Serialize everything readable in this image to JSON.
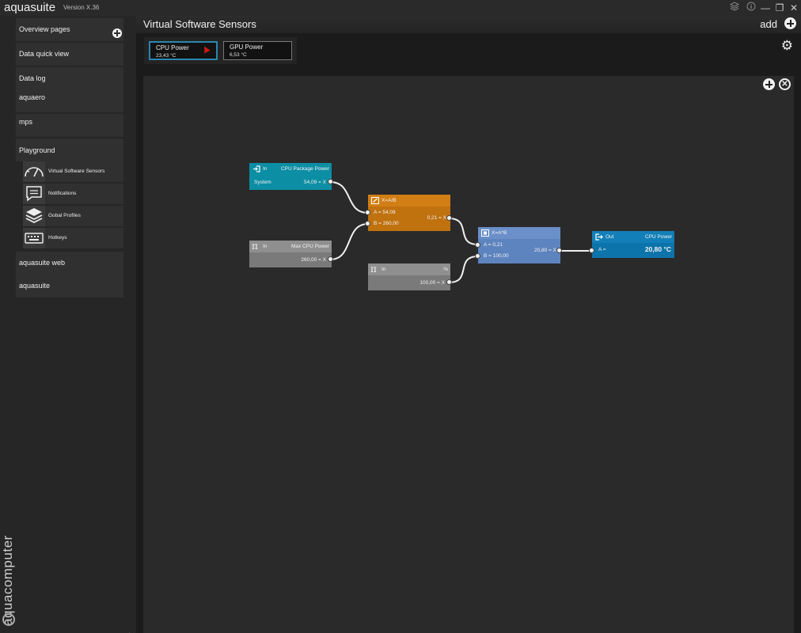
{
  "app": {
    "name": "aquasuite",
    "version": "Version X.36"
  },
  "window_controls": {
    "stack_icon": "stack-icon",
    "info_icon": "info-icon",
    "minimize": "—",
    "maximize": "❐",
    "close": "✕"
  },
  "sidebar": {
    "items": [
      {
        "label": "Overview pages"
      },
      {
        "label": "Data quick view"
      },
      {
        "label": "Data log"
      },
      {
        "label": "aquaero"
      },
      {
        "label": "mps"
      },
      {
        "label": "Playground"
      }
    ],
    "subitems": [
      {
        "label": "Virtual Software Sensors",
        "icon": "gauge-icon"
      },
      {
        "label": "Notifications",
        "icon": "chat-icon"
      },
      {
        "label": "Gobal Profiles",
        "icon": "layers-icon"
      },
      {
        "label": "Hotkeys",
        "icon": "keyboard-icon"
      }
    ],
    "bottom_items": [
      {
        "label": "aquasuite web"
      },
      {
        "label": "aquasuite"
      }
    ],
    "brand": "aquacomputer"
  },
  "header": {
    "title": "Virtual Software Sensors",
    "add_label": "add"
  },
  "sensor_tabs": [
    {
      "name": "CPU Power",
      "value": "23,43 °C",
      "active": true
    },
    {
      "name": "GPU Power",
      "value": "6,53 °C",
      "active": false
    }
  ],
  "nodes": {
    "in_cpu": {
      "type": "In",
      "title": "CPU Package Power",
      "source": "System",
      "value": "54,09 = X",
      "color": "#0c8ea4"
    },
    "in_max": {
      "type": "In",
      "title": "Max CPU Power",
      "value": "260,00 = X",
      "color": "#858585"
    },
    "in_pct": {
      "type": "In",
      "title": "%",
      "value": "100,00 = X",
      "color": "#858585"
    },
    "divide": {
      "formula": "X=A/B",
      "a": "A = 54,09",
      "b": "B = 260,00",
      "result": "0,21 = X",
      "color": "#cc7a14"
    },
    "multiply": {
      "formula": "X=A*B",
      "a": "A = 0,21",
      "b": "B = 100,00",
      "result": "20,80 = X",
      "color": "#5e84bf"
    },
    "out": {
      "type": "Out",
      "title": "CPU Power",
      "a": "A =",
      "value": "20,80 °C",
      "color": "#0e78b0"
    }
  }
}
